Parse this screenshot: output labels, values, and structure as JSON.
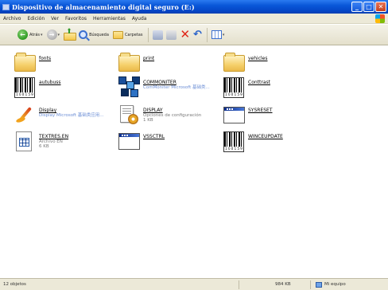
{
  "window": {
    "title": "Dispositivo de almacenamiento digital seguro (E:)",
    "controls": {
      "minimize": "_",
      "maximize": "□",
      "close": "✕"
    }
  },
  "menubar": {
    "items": [
      "Archivo",
      "Edición",
      "Ver",
      "Favoritos",
      "Herramientas",
      "Ayuda"
    ]
  },
  "toolbar": {
    "back_label": "Atrás",
    "search_label": "Búsqueda",
    "folders_label": "Carpetas"
  },
  "files": [
    {
      "name": "fonts",
      "sub1": "",
      "sub2": "",
      "icon": "folder-icon"
    },
    {
      "name": "print",
      "sub1": "",
      "sub2": "",
      "icon": "folder-icon"
    },
    {
      "name": "vehicles",
      "sub1": "",
      "sub2": "",
      "icon": "folder-icon"
    },
    {
      "name": "autubuss",
      "sub1": "",
      "sub2": "",
      "icon": "barcode-icon"
    },
    {
      "name": "COMMONITER",
      "sub1": "ComMoniter Microsoft 基础类...",
      "sub2": "",
      "icon": "cubes-icon"
    },
    {
      "name": "Conttrast",
      "sub1": "",
      "sub2": "",
      "icon": "barcode-icon"
    },
    {
      "name": "Display",
      "sub1": "Display Microsoft 基础类应用...",
      "sub2": "",
      "icon": "paintbrush-icon"
    },
    {
      "name": "DISPLAY",
      "sub1": "Opciones de configuración",
      "sub2": "1 KB",
      "icon": "settings-file-icon"
    },
    {
      "name": "SYSRESET",
      "sub1": "",
      "sub2": "",
      "icon": "window-icon"
    },
    {
      "name": "TEXTRES.EN",
      "sub1": "Archivo EN",
      "sub2": "6 KB",
      "icon": "calculator-icon"
    },
    {
      "name": "VSSCTRL",
      "sub1": "",
      "sub2": "",
      "icon": "window-icon"
    },
    {
      "name": "WINCEUPDATE",
      "sub1": "",
      "sub2": "",
      "icon": "barcode-icon"
    }
  ],
  "statusbar": {
    "objects": "12 objetos",
    "size": "984 KB",
    "location": "Mi equipo"
  },
  "colors": {
    "titlebar": "#0a57d8",
    "chrome": "#ece9d8",
    "link_gray": "#7a7a7a"
  }
}
